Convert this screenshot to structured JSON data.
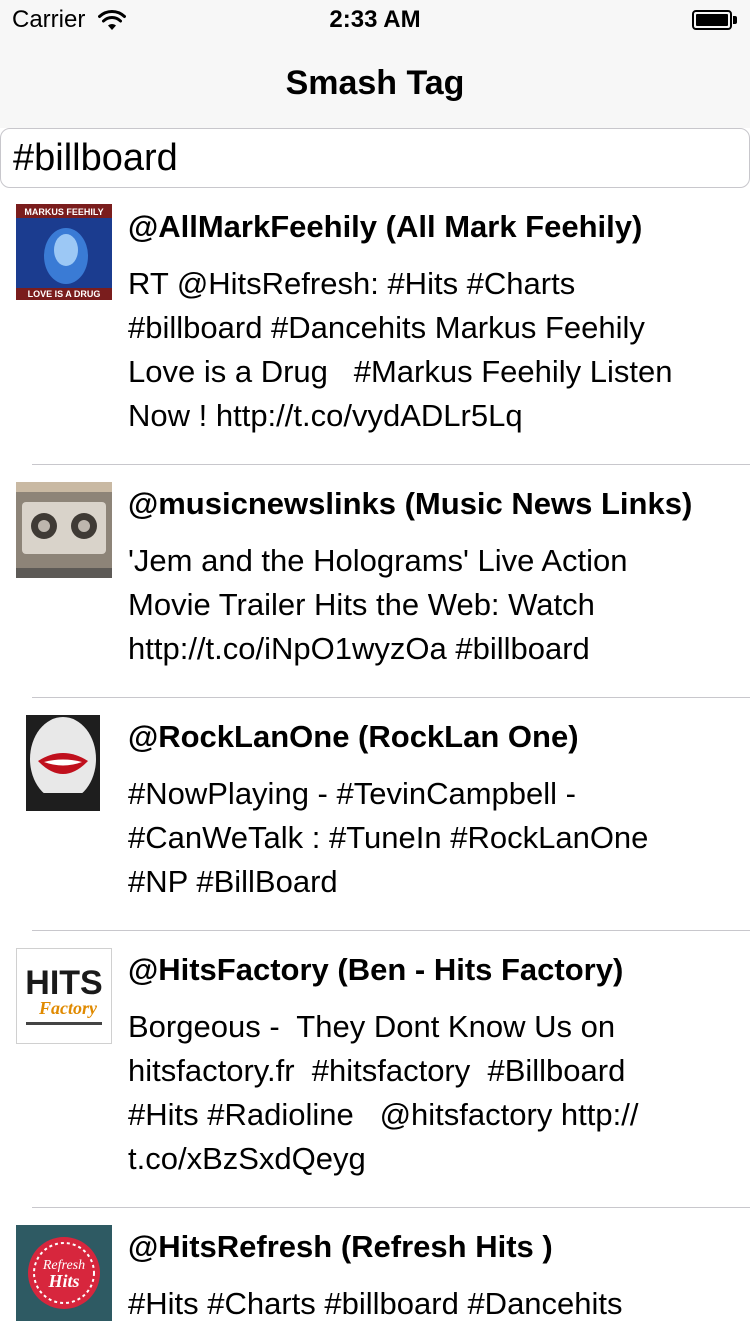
{
  "status_bar": {
    "carrier": "Carrier",
    "time": "2:33 AM"
  },
  "nav": {
    "title": "Smash Tag"
  },
  "search": {
    "value": "#billboard"
  },
  "tweets": [
    {
      "title": "@AllMarkFeehily (All Mark Feehily)",
      "lines": [
        "RT @HitsRefresh: #Hits #Charts",
        "#billboard #Dancehits Markus Feehily",
        "Love is a Drug   #Markus Feehily Listen",
        "Now ! http://t.co/vydADLr5Lq"
      ],
      "thumb_text": [
        "MARKUS FEEHILY",
        "LOVE IS A DRUG"
      ]
    },
    {
      "title": "@musicnewslinks (Music News Links)",
      "lines": [
        "'Jem and the Holograms' Live Action",
        "Movie Trailer Hits the Web: Watch",
        "http://t.co/iNpO1wyzOa #billboard"
      ]
    },
    {
      "title": "@RockLanOne (RockLan One)",
      "lines": [
        "#NowPlaying - #TevinCampbell -",
        "#CanWeTalk : #TuneIn #RockLanOne",
        "#NP #BillBoard"
      ]
    },
    {
      "title": "@HitsFactory (Ben - Hits Factory)",
      "lines": [
        "Borgeous -  They Dont Know Us on",
        "hitsfactory.fr  #hitsfactory  #Billboard",
        "#Hits #Radioline   @hitsfactory http://",
        "t.co/xBzSxdQeyg"
      ],
      "thumb_text": [
        "HITS",
        "Factory"
      ]
    },
    {
      "title": "@HitsRefresh (Refresh Hits )",
      "lines": [
        "#Hits #Charts #billboard #Dancehits"
      ],
      "thumb_text": [
        "Refresh",
        "Hits"
      ]
    }
  ]
}
